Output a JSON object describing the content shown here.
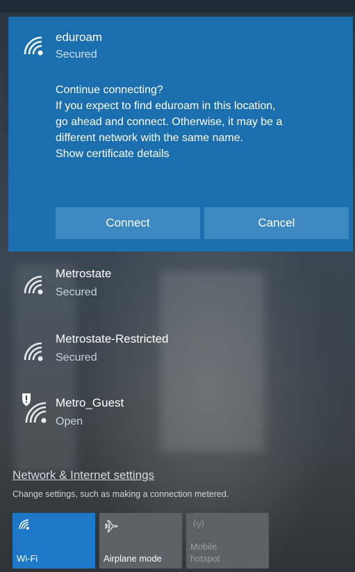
{
  "expanded_network": {
    "name": "eduroam",
    "status": "Secured",
    "prompt_lines": [
      "Continue connecting?",
      "If you expect to find eduroam in this location,",
      "go ahead and connect. Otherwise, it may be a",
      "different network with the same name."
    ],
    "certificate_link": "Show certificate details",
    "connect_label": "Connect",
    "cancel_label": "Cancel",
    "icon": "wifi-icon"
  },
  "networks": [
    {
      "name": "Metrostate",
      "status": "Secured",
      "icon": "wifi-icon"
    },
    {
      "name": "Metrostate-Restricted",
      "status": "Secured",
      "icon": "wifi-icon"
    },
    {
      "name": "Metro_Guest",
      "status": "Open",
      "icon": "wifi-shield-icon"
    }
  ],
  "settings": {
    "link": "Network & Internet settings",
    "description": "Change settings, such as making a connection metered."
  },
  "quick_actions": {
    "wifi": {
      "label": "Wi-Fi",
      "icon": "wifi-icon",
      "active": true
    },
    "airplane": {
      "label": "Airplane mode",
      "icon": "airplane-icon",
      "active": false
    },
    "hotspot": {
      "label_line1": "Mobile",
      "label_line2": "hotspot",
      "icon": "hotspot-icon",
      "active": false
    }
  },
  "colors": {
    "accent": "#1b6fae",
    "button": "#3d88c0",
    "wifi_tile": "#1e78c8"
  }
}
